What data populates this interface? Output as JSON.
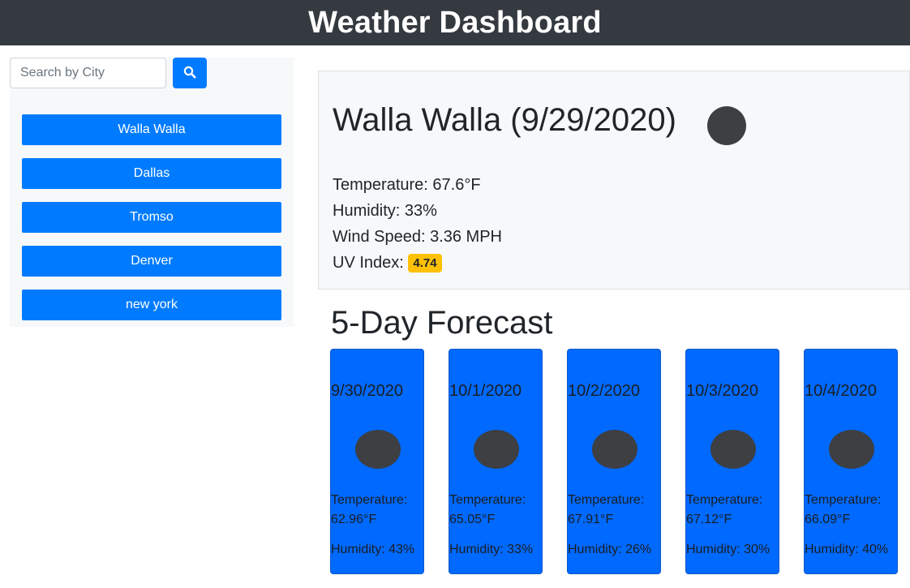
{
  "header": {
    "title": "Weather Dashboard"
  },
  "search": {
    "placeholder": "Search by City",
    "button_icon": "search-icon"
  },
  "cities": [
    "Walla Walla",
    "Dallas",
    "Tromso",
    "Denver",
    "new york"
  ],
  "current": {
    "heading": "Walla Walla (9/29/2020)",
    "temperature": "Temperature: 67.6°F",
    "humidity": "Humidity: 33%",
    "wind": "Wind Speed: 3.36 MPH",
    "uv_label": "UV Index: ",
    "uv_value": "4.74",
    "uv_color": "#ffc107"
  },
  "forecast": {
    "title": "5-Day Forecast",
    "days": [
      {
        "date": "9/30/2020",
        "temp_label": "Temperature:",
        "temp": "62.96°F",
        "humidity": "Humidity: 43%"
      },
      {
        "date": "10/1/2020",
        "temp_label": "Temperature:",
        "temp": "65.05°F",
        "humidity": "Humidity: 33%"
      },
      {
        "date": "10/2/2020",
        "temp_label": "Temperature:",
        "temp": "67.91°F",
        "humidity": "Humidity: 26%"
      },
      {
        "date": "10/3/2020",
        "temp_label": "Temperature:",
        "temp": "67.12°F",
        "humidity": "Humidity: 30%"
      },
      {
        "date": "10/4/2020",
        "temp_label": "Temperature:",
        "temp": "66.09°F",
        "humidity": "Humidity: 40%"
      }
    ]
  },
  "colors": {
    "header_bg": "#343a40",
    "primary": "#007bff",
    "card_bg": "#0069ff"
  }
}
